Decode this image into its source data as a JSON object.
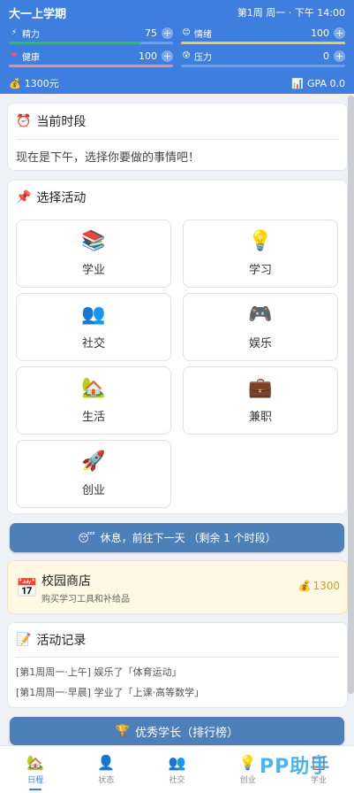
{
  "header": {
    "title": "大一上学期",
    "time": "第1周 周一 · 下午 14:00",
    "stats": [
      {
        "icon": "⚡",
        "icon_name": "lightning-icon",
        "label": "精力",
        "value": "75",
        "fill": 0.8,
        "color": "#2fbf4a"
      },
      {
        "icon": "😊",
        "icon_name": "smile-icon",
        "label": "情绪",
        "value": "100",
        "fill": 1.0,
        "color": "#f2c94c"
      },
      {
        "icon": "❤",
        "icon_name": "heart-icon",
        "label": "健康",
        "value": "100",
        "fill": 1.0,
        "color": "#f08a8a"
      },
      {
        "icon": "😰",
        "icon_name": "stress-face-icon",
        "label": "压力",
        "value": "0",
        "fill": 0.0,
        "color": "#f2994a"
      }
    ],
    "money": "1300元",
    "gpa": "GPA 0.0",
    "plus": "+"
  },
  "current_period": {
    "icon": "⏰",
    "title": "当前时段",
    "text": "现在是下午，选择你要做的事情吧！"
  },
  "activities": {
    "icon": "📌",
    "title": "选择活动",
    "items": [
      {
        "icon": "📚",
        "icon_name": "books-icon",
        "label": "学业"
      },
      {
        "icon": "💡",
        "icon_name": "lightbulb-icon",
        "label": "学习"
      },
      {
        "icon": "👥",
        "icon_name": "people-icon",
        "label": "社交"
      },
      {
        "icon": "🎮",
        "icon_name": "gamepad-icon",
        "label": "娱乐"
      },
      {
        "icon": "🏡",
        "icon_name": "house-icon",
        "label": "生活"
      },
      {
        "icon": "💼",
        "icon_name": "briefcase-icon",
        "label": "兼职"
      },
      {
        "icon": "🚀",
        "icon_name": "rocket-icon",
        "label": "创业"
      }
    ]
  },
  "rest_button": {
    "icon": "😴",
    "label": "休息，前往下一天 （剩余 1 个时段）"
  },
  "shop": {
    "icon": "📅",
    "title": "校园商店",
    "subtitle": "购买学习工具和补给品",
    "price_icon": "💰",
    "price": "1300"
  },
  "log": {
    "icon": "📝",
    "title": "活动记录",
    "entries": [
      "[第1周周一·上午] 娱乐了「体育运动」",
      "[第1周周一·早晨] 学业了「上课·高等数学」"
    ]
  },
  "leaderboard_button": {
    "icon": "🏆",
    "label": "优秀学长（排行榜）"
  },
  "tabs": [
    {
      "icon": "🏡",
      "icon_name": "home-icon",
      "label": "日程",
      "active": true
    },
    {
      "icon": "👤",
      "icon_name": "person-icon",
      "label": "状态",
      "active": false
    },
    {
      "icon": "👥",
      "icon_name": "people-icon",
      "label": "社交",
      "active": false
    },
    {
      "icon": "💡",
      "icon_name": "lightbulb-icon",
      "label": "创业",
      "active": false
    },
    {
      "icon": "📋",
      "icon_name": "clipboard-icon",
      "label": "学业",
      "active": false
    }
  ],
  "watermark": "PP助手",
  "colors": {
    "header_bg": "#3d7ede",
    "button_bg": "#4d7fb8",
    "shop_bg": "#fff9e3",
    "active_tab": "#3d7ede"
  }
}
